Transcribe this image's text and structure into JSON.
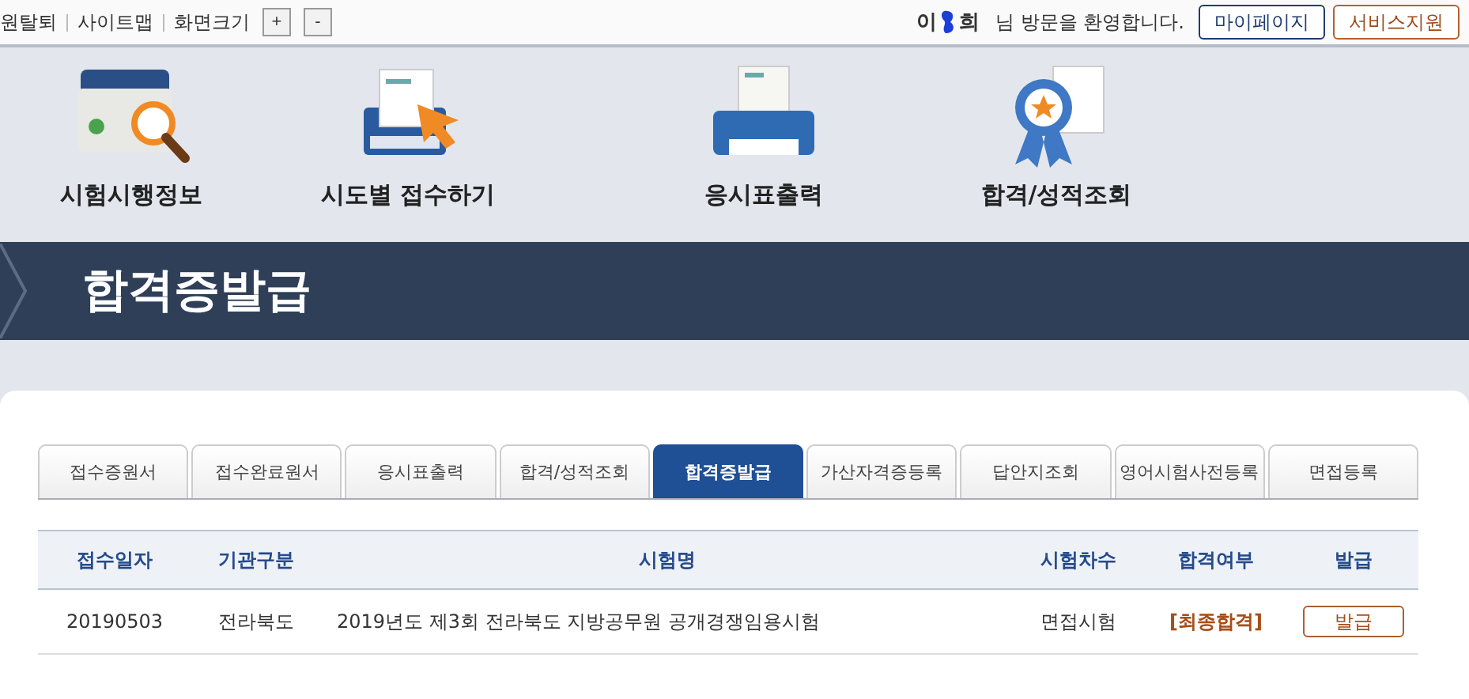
{
  "top_bar": {
    "links": [
      "원탈퇴",
      "사이트맵"
    ],
    "font_size_label": "화면크기",
    "font_buttons": [
      "+",
      "-"
    ],
    "user_name_start": "이",
    "user_name_end": "희",
    "welcome": "님 방문을 환영합니다.",
    "buttons": [
      {
        "label": "마이페이지",
        "kind": "primary"
      },
      {
        "label": "서비스지원",
        "kind": "accent"
      }
    ]
  },
  "menu": [
    {
      "label": "시험시행정보",
      "kind": "folder"
    },
    {
      "label": "시도별 접수하기",
      "kind": "laptop"
    },
    {
      "label": "응시표출력",
      "kind": "printer"
    },
    {
      "label": "합격/성적조회",
      "kind": "award"
    }
  ],
  "page_title": "합격증발급",
  "tabs": [
    {
      "label": "접수증원서",
      "selected": false
    },
    {
      "label": "접수완료원서",
      "selected": false
    },
    {
      "label": "응시표출력",
      "selected": false
    },
    {
      "label": "합격/성적조회",
      "selected": false
    },
    {
      "label": "합격증발급",
      "selected": true
    },
    {
      "label": "가산자격증등록",
      "selected": false
    },
    {
      "label": "답안지조회",
      "selected": false
    },
    {
      "label": "영어시험사전등록",
      "selected": false
    },
    {
      "label": "면접등록",
      "selected": false
    }
  ],
  "table": {
    "columns": [
      "접수일자",
      "기관구분",
      "시험명",
      "시험차수",
      "합격여부",
      "발급"
    ],
    "rows": [
      {
        "date": "20190503",
        "agency": "전라북도",
        "exam": "2019년도 제3회 전라북도 지방공무원 공개경쟁임용시험",
        "round": "면접시험",
        "result": "[최종합격]",
        "action": "발급"
      }
    ]
  }
}
